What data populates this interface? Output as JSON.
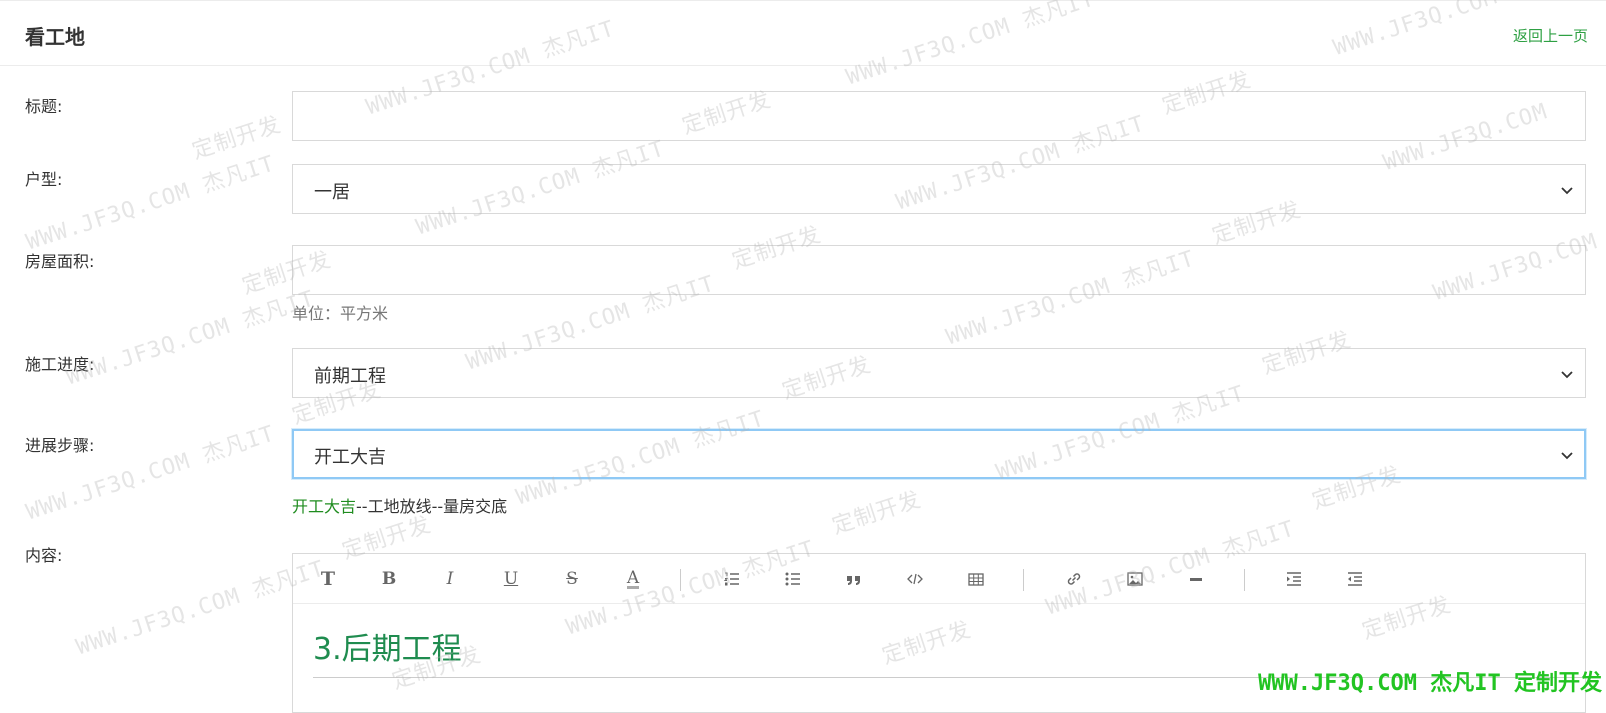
{
  "header": {
    "title": "看工地",
    "back_label": "返回上一页"
  },
  "form": {
    "title_label": "标题:",
    "title_value": "",
    "layout_label": "户型:",
    "layout_value": "一居",
    "area_label": "房屋面积:",
    "area_value": "",
    "area_hint": "单位：平方米",
    "progress_label": "施工进度:",
    "progress_value": "前期工程",
    "step_label": "进展步骤:",
    "step_value": "开工大吉",
    "steps": {
      "active": "开工大吉",
      "rest": "--工地放线--量房交底"
    },
    "content_label": "内容:"
  },
  "editor": {
    "toolbar": [
      {
        "name": "title-icon",
        "glyph": "T"
      },
      {
        "name": "bold-icon",
        "glyph": "B"
      },
      {
        "name": "italic-icon",
        "glyph": "I"
      },
      {
        "name": "underline-icon",
        "glyph": "U"
      },
      {
        "name": "strikethrough-icon",
        "glyph": "S"
      },
      {
        "name": "font-color-icon",
        "glyph": "A"
      },
      {
        "name": "ordered-list-icon"
      },
      {
        "name": "unordered-list-icon"
      },
      {
        "name": "blockquote-icon"
      },
      {
        "name": "code-icon"
      },
      {
        "name": "table-icon"
      },
      {
        "name": "link-icon"
      },
      {
        "name": "image-icon"
      },
      {
        "name": "horizontal-rule-icon"
      },
      {
        "name": "indent-icon"
      },
      {
        "name": "outdent-icon"
      }
    ],
    "heading": "3.后期工程"
  },
  "watermark": {
    "url": "WWW.JF3Q.COM",
    "brand": "杰凡IT",
    "slogan": "定制开发",
    "footer": "WWW.JF3Q.COM 杰凡IT  定制开发"
  },
  "colors": {
    "accent": "#2ea043",
    "focus": "#8fc9f5",
    "heading": "#1f8c4f"
  }
}
